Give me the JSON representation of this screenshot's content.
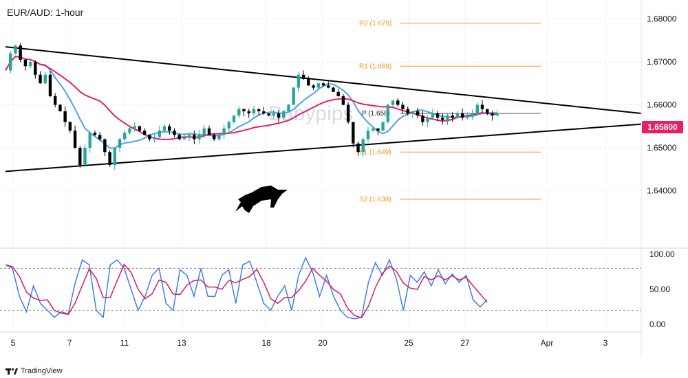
{
  "title": "EUR/AUD: 1-hour",
  "watermark": "Babypips",
  "brand": "TradingView",
  "colors": {
    "candle_up": "#26a69a",
    "candle_down": "#000000",
    "ma_fast": "#4da3e6",
    "ma_slow": "#e91e63",
    "pivot": "#f7931a",
    "trendline": "#000000",
    "price_tag": "#e91e63",
    "stoch_k": "#3d7de8",
    "stoch_d": "#d81b60"
  },
  "chart_data": {
    "type": "candlestick",
    "price_axis": {
      "ticks": [
        "1.68000",
        "1.67000",
        "1.66000",
        "1.65000",
        "1.64000"
      ],
      "ylim": [
        1.63,
        1.682
      ]
    },
    "date_axis": {
      "ticks": [
        "5",
        "7",
        "11",
        "13",
        "18",
        "20",
        "25",
        "27",
        "Apr",
        "3"
      ]
    },
    "current_price": "1.65800",
    "pivot_levels": [
      {
        "label": "R2 (1.679)",
        "value": 1.679
      },
      {
        "label": "R1 (1.669)",
        "value": 1.669
      },
      {
        "label": "P (1.658)",
        "value": 1.658
      },
      {
        "label": "S1 (1.649)",
        "value": 1.649
      },
      {
        "label": "S2 (1.638)",
        "value": 1.638
      }
    ],
    "trendlines": [
      {
        "name": "resistance",
        "from": [
          0,
          1.6735
        ],
        "to": [
          128,
          1.658
        ]
      },
      {
        "name": "support",
        "from": [
          0,
          1.6445
        ],
        "to": [
          128,
          1.6555
        ]
      }
    ],
    "close_path": [
      [
        0,
        1.668
      ],
      [
        1,
        1.672
      ],
      [
        2,
        1.6738
      ],
      [
        3,
        1.6705
      ],
      [
        4,
        1.669
      ],
      [
        5,
        1.67
      ],
      [
        6,
        1.667
      ],
      [
        7,
        1.665
      ],
      [
        8,
        1.667
      ],
      [
        9,
        1.662
      ],
      [
        10,
        1.66
      ],
      [
        11,
        1.6585
      ],
      [
        12,
        1.656
      ],
      [
        13,
        1.654
      ],
      [
        14,
        1.65
      ],
      [
        15,
        1.646
      ],
      [
        16,
        1.65
      ],
      [
        17,
        1.6535
      ],
      [
        18,
        1.653
      ],
      [
        19,
        1.652
      ],
      [
        20,
        1.649
      ],
      [
        21,
        1.646
      ],
      [
        22,
        1.65
      ],
      [
        23,
        1.652
      ],
      [
        24,
        1.6535
      ],
      [
        25,
        1.6545
      ],
      [
        26,
        1.655
      ],
      [
        27,
        1.654
      ],
      [
        28,
        1.653
      ],
      [
        29,
        1.652
      ],
      [
        30,
        1.6525
      ],
      [
        31,
        1.654
      ],
      [
        32,
        1.655
      ],
      [
        33,
        1.654
      ],
      [
        34,
        1.653
      ],
      [
        35,
        1.652
      ],
      [
        36,
        1.6525
      ],
      [
        37,
        1.653
      ],
      [
        38,
        1.652
      ],
      [
        39,
        1.653
      ],
      [
        40,
        1.6545
      ],
      [
        41,
        1.653
      ],
      [
        42,
        1.652
      ],
      [
        43,
        1.653
      ],
      [
        44,
        1.6545
      ],
      [
        45,
        1.656
      ],
      [
        46,
        1.6575
      ],
      [
        47,
        1.659
      ],
      [
        48,
        1.6585
      ],
      [
        49,
        1.658
      ],
      [
        50,
        1.659
      ],
      [
        51,
        1.6585
      ],
      [
        52,
        1.658
      ],
      [
        53,
        1.6575
      ],
      [
        54,
        1.658
      ],
      [
        55,
        1.657
      ],
      [
        56,
        1.6585
      ],
      [
        57,
        1.66
      ],
      [
        58,
        1.664
      ],
      [
        59,
        1.667
      ],
      [
        60,
        1.666
      ],
      [
        61,
        1.6645
      ],
      [
        62,
        1.664
      ],
      [
        63,
        1.665
      ],
      [
        64,
        1.6645
      ],
      [
        65,
        1.664
      ],
      [
        66,
        1.663
      ],
      [
        67,
        1.662
      ],
      [
        68,
        1.66
      ],
      [
        69,
        1.656
      ],
      [
        70,
        1.651
      ],
      [
        71,
        1.649
      ],
      [
        72,
        1.652
      ],
      [
        73,
        1.654
      ],
      [
        74,
        1.6545
      ],
      [
        75,
        1.654
      ],
      [
        76,
        1.656
      ],
      [
        77,
        1.66
      ],
      [
        78,
        1.661
      ],
      [
        79,
        1.66
      ],
      [
        80,
        1.659
      ],
      [
        81,
        1.658
      ],
      [
        82,
        1.6585
      ],
      [
        83,
        1.6575
      ],
      [
        84,
        1.656
      ],
      [
        85,
        1.657
      ],
      [
        86,
        1.658
      ],
      [
        87,
        1.657
      ],
      [
        88,
        1.6565
      ],
      [
        89,
        1.6575
      ],
      [
        90,
        1.657
      ],
      [
        91,
        1.658
      ],
      [
        92,
        1.657
      ],
      [
        93,
        1.6575
      ],
      [
        94,
        1.658
      ],
      [
        95,
        1.66
      ],
      [
        96,
        1.659
      ],
      [
        97,
        1.658
      ],
      [
        98,
        1.6575
      ],
      [
        99,
        1.658
      ]
    ],
    "stochastic": {
      "ticks": [
        "100.00",
        "50.00",
        "0.00"
      ],
      "ylim": [
        0,
        100
      ],
      "levels": [
        80,
        20
      ],
      "k_path": [
        [
          0,
          85
        ],
        [
          2,
          80
        ],
        [
          4,
          40
        ],
        [
          6,
          18
        ],
        [
          8,
          55
        ],
        [
          10,
          30
        ],
        [
          12,
          20
        ],
        [
          14,
          10
        ],
        [
          16,
          18
        ],
        [
          18,
          15
        ],
        [
          20,
          60
        ],
        [
          22,
          92
        ],
        [
          24,
          85
        ],
        [
          26,
          20
        ],
        [
          28,
          10
        ],
        [
          30,
          85
        ],
        [
          32,
          92
        ],
        [
          34,
          80
        ],
        [
          36,
          50
        ],
        [
          38,
          20
        ],
        [
          40,
          40
        ],
        [
          42,
          70
        ],
        [
          44,
          80
        ],
        [
          46,
          30
        ],
        [
          48,
          20
        ],
        [
          50,
          78
        ],
        [
          52,
          70
        ],
        [
          54,
          40
        ],
        [
          56,
          80
        ],
        [
          58,
          40
        ],
        [
          60,
          40
        ],
        [
          62,
          70
        ],
        [
          64,
          78
        ],
        [
          66,
          30
        ],
        [
          68,
          85
        ],
        [
          70,
          90
        ],
        [
          72,
          60
        ],
        [
          74,
          30
        ],
        [
          76,
          20
        ],
        [
          78,
          40
        ],
        [
          80,
          55
        ],
        [
          82,
          20
        ],
        [
          84,
          70
        ],
        [
          86,
          95
        ],
        [
          88,
          75
        ],
        [
          90,
          40
        ],
        [
          92,
          70
        ],
        [
          94,
          40
        ],
        [
          96,
          20
        ],
        [
          98,
          10
        ],
        [
          100,
          8
        ],
        [
          102,
          10
        ],
        [
          104,
          60
        ],
        [
          106,
          88
        ],
        [
          108,
          70
        ],
        [
          110,
          92
        ],
        [
          112,
          65
        ],
        [
          114,
          20
        ],
        [
          116,
          70
        ],
        [
          118,
          60
        ],
        [
          120,
          75
        ],
        [
          122,
          55
        ],
        [
          124,
          78
        ],
        [
          126,
          58
        ],
        [
          128,
          72
        ],
        [
          130,
          60
        ],
        [
          132,
          70
        ],
        [
          134,
          35
        ],
        [
          136,
          25
        ],
        [
          138,
          35
        ]
      ]
    }
  }
}
